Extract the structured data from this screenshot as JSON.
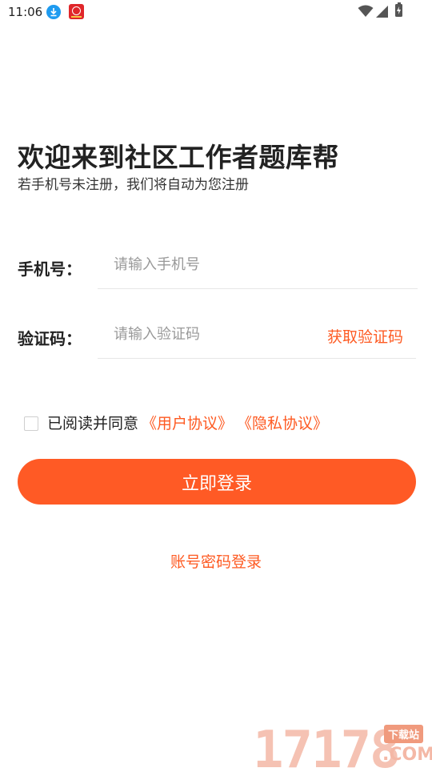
{
  "status_bar": {
    "time": "11:06",
    "icons": [
      "download-notification-icon",
      "app-notification-icon",
      "wifi-icon",
      "cell-signal-icon",
      "battery-charging-icon"
    ]
  },
  "welcome": {
    "title": "欢迎来到社区工作者题库帮",
    "subtitle": "若手机号未注册，我们将自动为您注册"
  },
  "form": {
    "phone_label": "手机号：",
    "phone_placeholder": "请输入手机号",
    "phone_value": "",
    "code_label": "验证码：",
    "code_placeholder": "请输入验证码",
    "code_value": "",
    "get_code": "获取验证码"
  },
  "agreement": {
    "checked": false,
    "text": "已阅读并同意",
    "user_agreement": "《用户协议》",
    "privacy_policy": "《隐私协议》"
  },
  "login_button": "立即登录",
  "password_login": "账号密码登录",
  "watermark": {
    "number": "17178",
    "badge": "下载站",
    "domain": ".COM"
  },
  "colors": {
    "accent": "#ff5a25",
    "link": "#fe5a22",
    "text": "#222222",
    "placeholder": "#999999",
    "divider": "#e6e6e6"
  }
}
